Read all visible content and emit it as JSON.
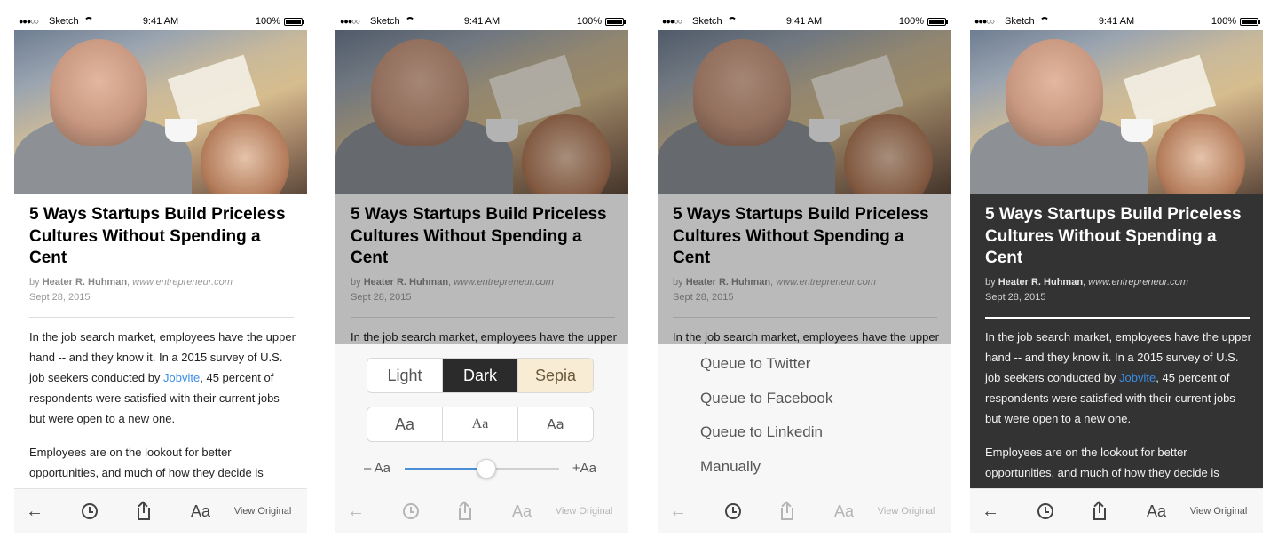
{
  "status": {
    "signal": "●●●○○",
    "carrier": "Sketch",
    "time": "9:41 AM",
    "battery": "100%"
  },
  "article": {
    "title": "5 Ways Startups Build Priceless Cultures Without Spending a Cent",
    "by_prefix": "by",
    "author": "Heater R. Huhman",
    "source": "www.entrepreneur.com",
    "date": "Sept 28, 2015",
    "para1_a": "In the job search market, employees have the upper hand -- and they know it. In a 2015 survey of U.S. job seekers conducted by ",
    "para1_link": "Jobvite",
    "para1_b": ", 45 percent of respondents were satisfied with their current jobs but were open to a new one.",
    "para2": "Employees are on the lookout for better opportunities, and much of how they decide is"
  },
  "toolbar": {
    "back_icon": "←",
    "aa_label": "Aa",
    "view_original": "View Original"
  },
  "theme_panel": {
    "themes": [
      "Light",
      "Dark",
      "Sepia"
    ],
    "selected_theme": "Dark",
    "fonts": [
      "Aa",
      "Aa",
      "Aa"
    ],
    "size_min": "– Aa",
    "size_max": "+Aa",
    "size_level": 0.53
  },
  "queue_menu": {
    "items": [
      "Queue to Twitter",
      "Queue to Facebook",
      "Queue to Linkedin",
      "Manually"
    ]
  },
  "colors": {
    "link": "#3a8ee6",
    "slider": "#4a8fd8",
    "dark_bg": "#333333",
    "sepia_bg": "#f8ecd5"
  },
  "icons": [
    "back-arrow-icon",
    "clock-icon",
    "share-icon",
    "font-size-icon",
    "wifi-icon",
    "battery-icon"
  ]
}
